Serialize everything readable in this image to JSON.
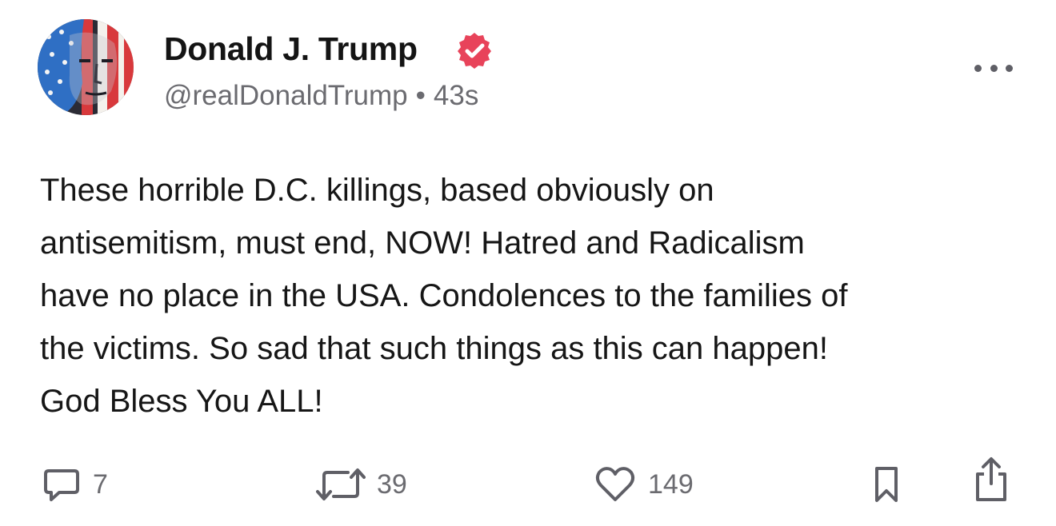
{
  "post": {
    "author": {
      "display_name": "Donald J. Trump",
      "handle": "@realDonaldTrump",
      "verified": true,
      "verified_color": "#e8435a"
    },
    "separator": "•",
    "timestamp": "43s",
    "text_lines": [
      "These horrible D.C. killings, based obviously on",
      "antisemitism, must end, NOW! Hatred and Radicalism",
      "have no place in the USA. Condolences to the families of",
      "the victims. So sad that such things as this can happen!",
      "God Bless You ALL!"
    ],
    "actions": {
      "replies": {
        "icon": "comment-icon",
        "count": "7"
      },
      "reposts": {
        "icon": "repost-icon",
        "count": "39"
      },
      "likes": {
        "icon": "heart-icon",
        "count": "149"
      },
      "bookmark": {
        "icon": "bookmark-icon"
      },
      "share": {
        "icon": "share-icon"
      }
    }
  },
  "colors": {
    "text_primary": "#141414",
    "text_secondary": "#6b6b70",
    "icon_gray": "#5f5f66"
  }
}
